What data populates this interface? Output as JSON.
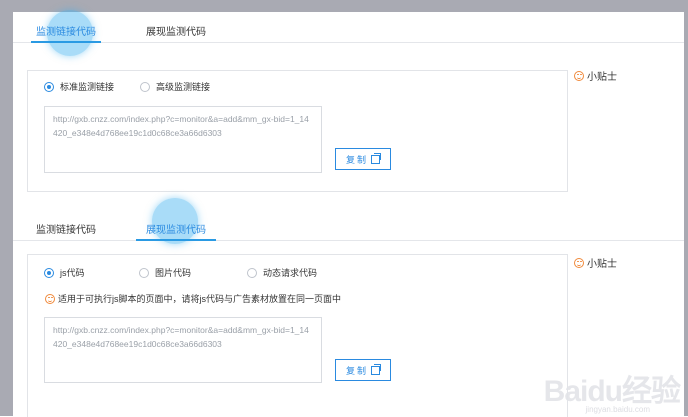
{
  "section1": {
    "tabs": [
      {
        "label": "监测链接代码",
        "active": true
      },
      {
        "label": "展现监测代码",
        "active": false
      }
    ],
    "radios": [
      {
        "label": "标准监测链接",
        "checked": true
      },
      {
        "label": "高级监测链接",
        "checked": false
      }
    ],
    "code": "http://gxb.cnzz.com/index.php?c=monitor&a=add&mm_gx-bid=1_14420_e348e4d768ee19c1d0c68ce3a66d6303",
    "copy_label": "复制",
    "tip_label": "小贴士"
  },
  "section2": {
    "tabs": [
      {
        "label": "监测链接代码",
        "active": false
      },
      {
        "label": "展现监测代码",
        "active": true
      }
    ],
    "radios": [
      {
        "label": "js代码",
        "checked": true
      },
      {
        "label": "图片代码",
        "checked": false
      },
      {
        "label": "动态请求代码",
        "checked": false
      }
    ],
    "hint": "适用于可执行js脚本的页面中，请将js代码与广告素材放置在同一页面中",
    "code": "http://gxb.cnzz.com/index.php?c=monitor&a=add&mm_gx-bid=1_14420_e348e4d768ee19c1d0c68ce3a66d6303",
    "copy_label": "复制",
    "tip_label": "小贴士"
  },
  "watermark": {
    "text": "Baidu经验",
    "url": "jingyan.baidu.com"
  },
  "colors": {
    "accent": "#2a8ae0",
    "tip_icon": "#f08a3c",
    "frame": "#a9aab3"
  }
}
